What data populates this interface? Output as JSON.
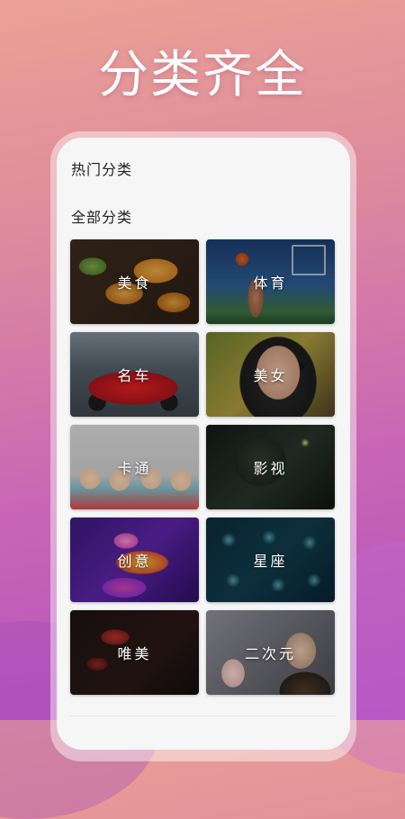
{
  "promo": {
    "headline": "分类齐全"
  },
  "screen": {
    "hot_section_title": "热门分类",
    "all_section_title": "全部分类",
    "categories": [
      {
        "label": "美食",
        "icon": "food-thumbnail"
      },
      {
        "label": "体育",
        "icon": "sport-thumbnail"
      },
      {
        "label": "名车",
        "icon": "car-thumbnail"
      },
      {
        "label": "美女",
        "icon": "beauty-thumbnail"
      },
      {
        "label": "卡通",
        "icon": "cartoon-thumbnail"
      },
      {
        "label": "影视",
        "icon": "film-thumbnail"
      },
      {
        "label": "创意",
        "icon": "creative-thumbnail"
      },
      {
        "label": "星座",
        "icon": "constellation-thumbnail"
      },
      {
        "label": "唯美",
        "icon": "aesthetic-thumbnail"
      },
      {
        "label": "二次元",
        "icon": "anime-thumbnail"
      }
    ]
  },
  "colors": {
    "background_top": "#eaa294",
    "background_bottom": "#b24fbf",
    "screen_bg": "#f6f6f7",
    "headline_text": "#ffffff",
    "section_text": "#222222"
  }
}
